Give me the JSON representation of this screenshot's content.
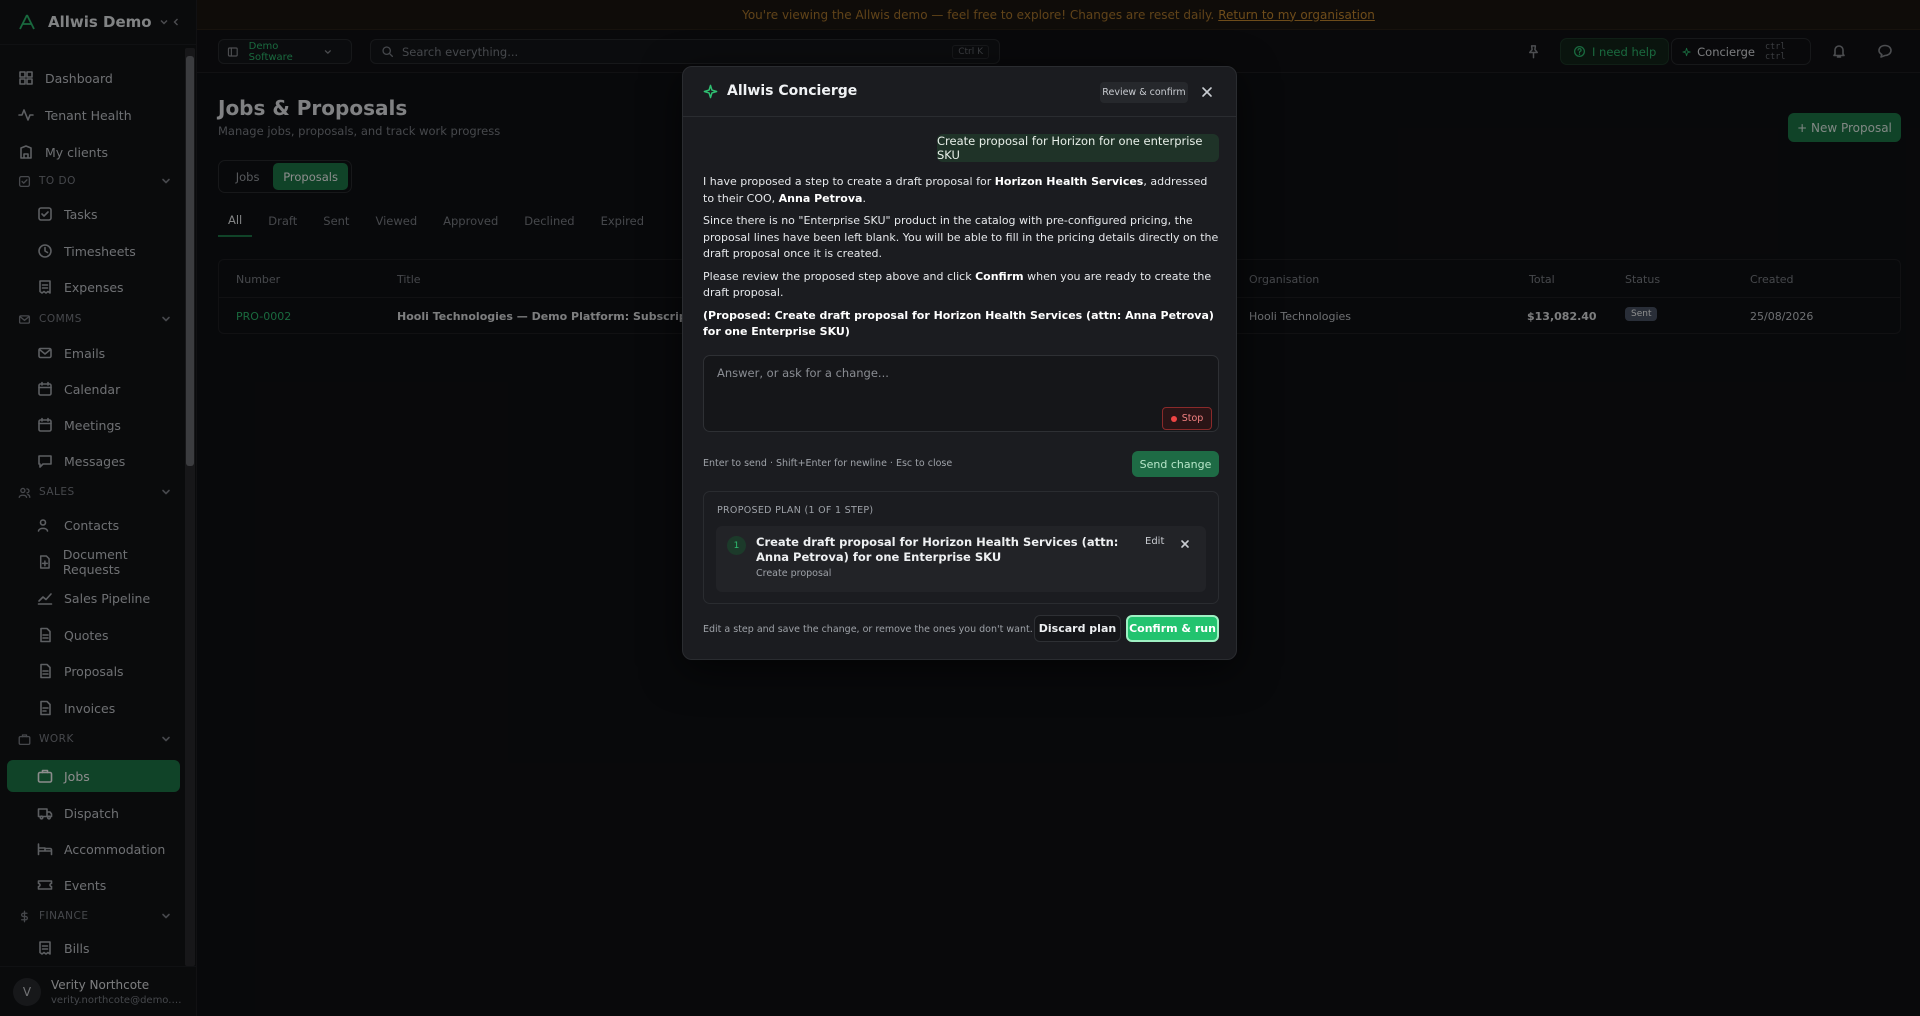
{
  "banner": {
    "text": "You're viewing the Allwis demo — feel free to explore! Changes are reset daily.",
    "link": "Return to my organisation"
  },
  "brand": {
    "name": "Allwis Demo"
  },
  "sidebar": {
    "top": [
      {
        "label": "Dashboard",
        "icon": "grid-icon"
      },
      {
        "label": "Tenant Health",
        "icon": "activity-icon"
      },
      {
        "label": "My clients",
        "icon": "building-icon"
      }
    ],
    "sections": {
      "todo": {
        "label": "TO DO",
        "items": [
          "Tasks",
          "Timesheets",
          "Expenses"
        ]
      },
      "comms": {
        "label": "COMMS",
        "items": [
          "Emails",
          "Calendar",
          "Meetings",
          "Messages"
        ]
      },
      "sales": {
        "label": "SALES",
        "items": [
          "Contacts",
          "Document Requests",
          "Sales Pipeline",
          "Quotes",
          "Proposals",
          "Invoices"
        ]
      },
      "work": {
        "label": "WORK",
        "items": [
          "Jobs",
          "Dispatch",
          "Accommodation",
          "Events"
        ]
      },
      "finance": {
        "label": "FINANCE",
        "items": [
          "Bills"
        ]
      }
    },
    "active": "Jobs",
    "accent": "#1e7a4a"
  },
  "user": {
    "initial": "V",
    "name": "Verity Northcote",
    "email": "verity.northcote@demo.allwis.com"
  },
  "topbar": {
    "workspace": "Demo Software",
    "search_placeholder": "Search everything...",
    "search_kbd": "Ctrl K",
    "help": "I need help",
    "concierge": "Concierge",
    "concierge_kbd": "ctrl ctrl"
  },
  "page": {
    "title": "Jobs & Proposals",
    "subtitle": "Manage jobs, proposals, and track work progress",
    "new_button": "+ New Proposal",
    "segments": [
      "Jobs",
      "Proposals"
    ],
    "filters": [
      "All",
      "Draft",
      "Sent",
      "Viewed",
      "Approved",
      "Declined",
      "Expired"
    ],
    "table": {
      "headers": [
        "Number",
        "Title",
        "Organisation",
        "Total",
        "Status",
        "Created"
      ],
      "rows": [
        {
          "number": "PRO-0002",
          "title": "Hooli Technologies — Demo Platform: Subscription & Im",
          "org": "Hooli Technologies",
          "total": "$13,082.40",
          "status": "Sent",
          "created": "25/08/2026"
        }
      ]
    }
  },
  "modal": {
    "title": "Allwis Concierge",
    "badge": "Review & confirm",
    "user_message": "Create proposal for Horizon for one enterprise SKU",
    "p1": {
      "a": "I have proposed a step to create a draft proposal for ",
      "b": "Horizon Health Services",
      "c": ", addressed to their COO, ",
      "d": "Anna Petrova",
      "e": "."
    },
    "p2": "Since there is no \"Enterprise SKU\" product in the catalog with pre-configured pricing, the proposal lines have been left blank. You will be able to fill in the pricing details directly on the draft proposal once it is created.",
    "p3": {
      "a": "Please review the proposed step above and click ",
      "b": "Confirm",
      "c": " when you are ready to create the draft proposal."
    },
    "p4": "(Proposed: Create draft proposal for Horizon Health Services (attn: Anna Petrova) for one Enterprise SKU)",
    "input_placeholder": "Answer, or ask for a change...",
    "stop": "Stop",
    "hint": "Enter to send · Shift+Enter for newline · Esc to close",
    "send": "Send change",
    "plan_header": "PROPOSED PLAN (1 OF 1 STEP)",
    "step": {
      "num": "1",
      "title": "Create draft proposal for Horizon Health Services (attn: Anna Petrova) for one Enterprise SKU",
      "sub": "Create proposal",
      "edit": "Edit"
    },
    "foot_hint": "Edit a step and save the change, or remove the ones you don't want.",
    "discard": "Discard plan",
    "confirm": "Confirm & run"
  }
}
